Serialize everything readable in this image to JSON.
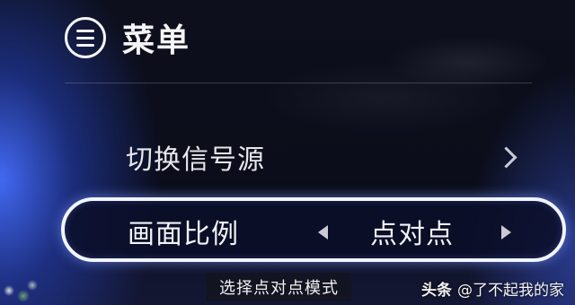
{
  "header": {
    "icon": "menu-icon",
    "title": "菜单"
  },
  "menu": {
    "items": [
      {
        "label": "切换信号源",
        "icon": "chevron-right-icon"
      },
      {
        "label": "画面比例",
        "value": "点对点",
        "selected": true
      }
    ]
  },
  "hint": "选择点对点模式",
  "watermark": {
    "brand": "头条",
    "handle": "@了不起我的家"
  },
  "colors": {
    "text": "#f2f3f8",
    "selected_border": "#f2f4ff",
    "glow": "#4a6eff",
    "background": "#0b0d1a"
  }
}
